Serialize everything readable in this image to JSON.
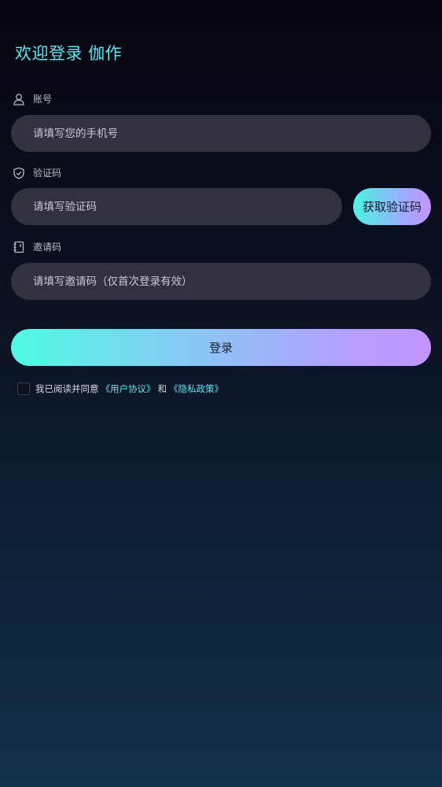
{
  "header": {
    "title": "欢迎登录 伽作"
  },
  "account": {
    "label": "账号",
    "icon": "user-icon",
    "placeholder": "请填写您的手机号"
  },
  "code": {
    "label": "验证码",
    "icon": "shield-check-icon",
    "placeholder": "请填写验证码",
    "button_label": "获取验证码"
  },
  "invite": {
    "label": "邀请码",
    "icon": "notebook-icon",
    "placeholder": "请填写邀请码（仅首次登录有效）"
  },
  "login": {
    "button_label": "登录"
  },
  "agreement": {
    "checked": false,
    "prefix": "我已阅读并同意",
    "user_agreement": "《用户协议》",
    "connector": "和",
    "privacy_policy": "《隐私政策》"
  },
  "colors": {
    "accent": "#5fe6f0",
    "input_bg": "#31313f",
    "gradient_start": "#4efbe2",
    "gradient_end": "#c493ff"
  }
}
